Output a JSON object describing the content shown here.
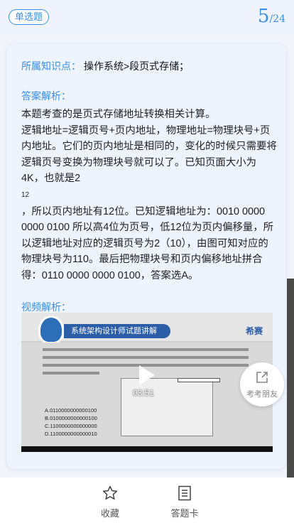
{
  "header": {
    "question_type": "单选题",
    "current_page": "5",
    "total_pages": "/24"
  },
  "knowledge": {
    "label": "所属知识点：",
    "value": "操作系统>段页式存储；"
  },
  "answer": {
    "label": "答案解析：",
    "para1": "本题考查的是页式存储地址转换相关计算。",
    "para2": "逻辑地址=逻辑页号+页内地址，物理地址=物理块号+页内地址。它们的页内地址是相同的，变化的时候只需要将逻辑页号变换为物理块号就可以了。已知页面大小为4K，也就是2",
    "sup": "12",
    "para3": "，所以页内地址有12位。已知逻辑地址为：0010 0000 0000 0100 所以高4位为页号，低12位为页内偏移量，所以逻辑地址对应的逻辑页号为2（10），由图可知对应的物理块号为110。最后把物理块号和页内偏移地址拼合得：0110 0000 0000 0100，答案选A。"
  },
  "video": {
    "label": "视频解析：",
    "banner_title": "系统架构设计师试题讲解",
    "brand": "希赛",
    "duration": "03:51",
    "options": [
      "A.0110000000000100",
      "B.0100000000000100",
      "C.1100000000000000",
      "D.1100000000000010"
    ]
  },
  "share": {
    "label": "考考朋友",
    "icon": "share-icon"
  },
  "bottom_nav": {
    "favorite_label": "收藏",
    "answer_card_label": "答题卡"
  },
  "colors": {
    "accent": "#3a8ee6",
    "card_bg": "#eef4fe"
  }
}
